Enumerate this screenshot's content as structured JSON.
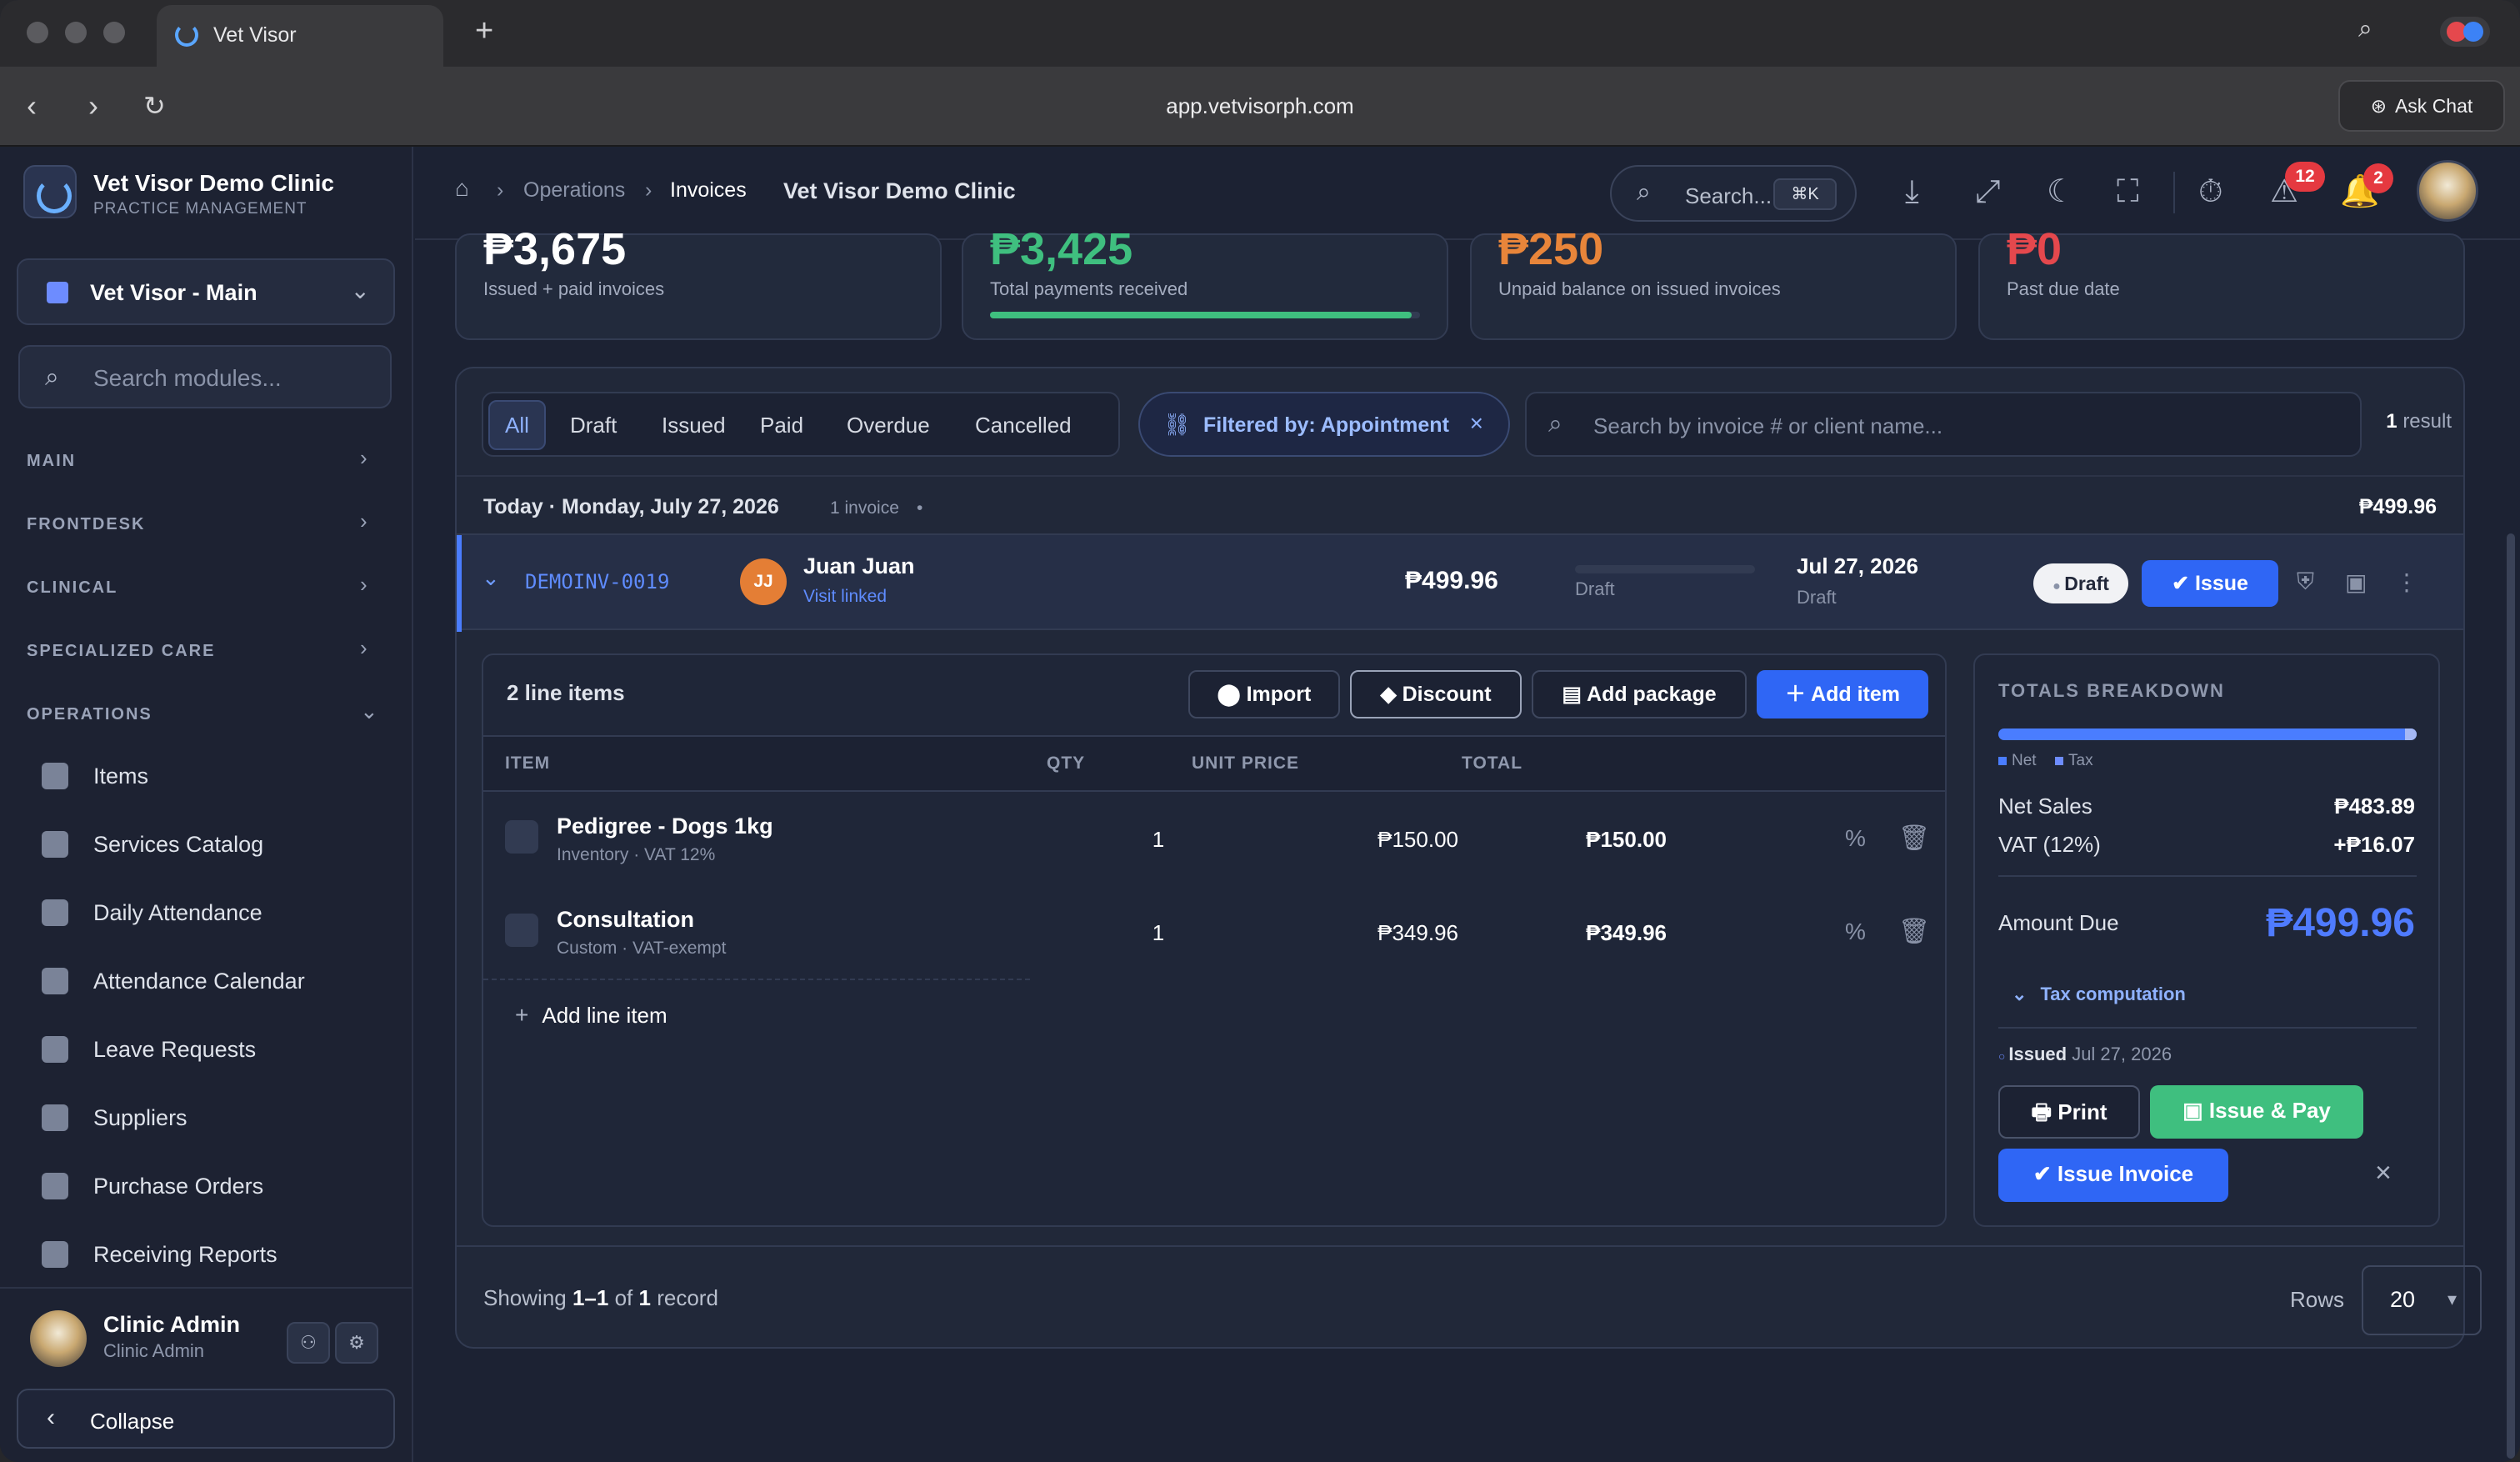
{
  "browser": {
    "tab_title": "Vet Visor",
    "url": "app.vetvisorph.com",
    "ask_chat": "Ask Chat"
  },
  "sidebar": {
    "clinic_name": "Vet Visor Demo Clinic",
    "clinic_sub": "PRACTICE MANAGEMENT",
    "branch": "Vet Visor - Main",
    "search_placeholder": "Search modules...",
    "sections": [
      "MAIN",
      "FRONTDESK",
      "CLINICAL",
      "SPECIALIZED CARE",
      "OPERATIONS"
    ],
    "items": [
      "Items",
      "Services Catalog",
      "Daily Attendance",
      "Attendance Calendar",
      "Leave Requests",
      "Suppliers",
      "Purchase Orders",
      "Receiving Reports"
    ],
    "user_name": "Clinic Admin",
    "user_role": "Clinic Admin",
    "collapse": "Collapse"
  },
  "header": {
    "crumbs": [
      "Operations",
      "Invoices"
    ],
    "clinic": "Vet Visor Demo Clinic",
    "search": "Search...",
    "shortcut": "⌘K",
    "alerts_count": "12",
    "notif_count": "2"
  },
  "stats": [
    {
      "value": "₱3,675",
      "label": "Issued + paid invoices",
      "color": "#ffffff"
    },
    {
      "value": "₱3,425",
      "label": "Total payments received",
      "color": "#3fbf7f"
    },
    {
      "value": "₱250",
      "label": "Unpaid balance on issued invoices",
      "color": "#e8853a"
    },
    {
      "value": "₱0",
      "label": "Past due date",
      "color": "#e5484d"
    }
  ],
  "filters": {
    "tabs": [
      "All",
      "Draft",
      "Issued",
      "Paid",
      "Overdue",
      "Cancelled"
    ],
    "active": "All",
    "filtered_by": "Filtered by: Appointment",
    "search_placeholder": "Search by invoice # or client name...",
    "result_count": "1",
    "result_label": "result"
  },
  "group": {
    "label": "Today · Monday, July 27, 2026",
    "count": "1 invoice",
    "total": "₱499.96"
  },
  "invoice": {
    "number": "DEMOINV-0019",
    "initials": "JJ",
    "client": "Juan Juan",
    "visit": "Visit linked",
    "amount": "₱499.96",
    "progress_label": "Draft",
    "date": "Jul 27, 2026",
    "date_label": "Draft",
    "status": "Draft",
    "issue_btn": "Issue"
  },
  "lines": {
    "header": "2 line items",
    "buttons": {
      "import": "Import",
      "discount": "Discount",
      "add_package": "Add package",
      "add_item": "Add item"
    },
    "columns": [
      "ITEM",
      "QTY",
      "UNIT PRICE",
      "TOTAL"
    ],
    "rows": [
      {
        "name": "Pedigree - Dogs 1kg",
        "sub": "Inventory · VAT 12%",
        "qty": "1",
        "unit": "₱150.00",
        "total": "₱150.00"
      },
      {
        "name": "Consultation",
        "sub": "Custom · VAT-exempt",
        "qty": "1",
        "unit": "₱349.96",
        "total": "₱349.96"
      }
    ],
    "add_line": "Add line item"
  },
  "totals": {
    "title": "TOTALS BREAKDOWN",
    "legend_net": "Net",
    "legend_tax": "Tax",
    "net_label": "Net Sales",
    "net_value": "₱483.89",
    "vat_label": "VAT (12%)",
    "vat_value": "+₱16.07",
    "due_label": "Amount Due",
    "due_value": "₱499.96",
    "tax_comp": "Tax computation",
    "issued_label": "Issued",
    "issued_date": "Jul 27, 2026",
    "print": "Print",
    "issue_pay": "Issue & Pay",
    "issue_invoice": "Issue Invoice"
  },
  "footer": {
    "showing_prefix": "Showing",
    "range": "1–1",
    "of": "of",
    "total": "1",
    "record": "record",
    "rows_label": "Rows",
    "rows_value": "20"
  }
}
